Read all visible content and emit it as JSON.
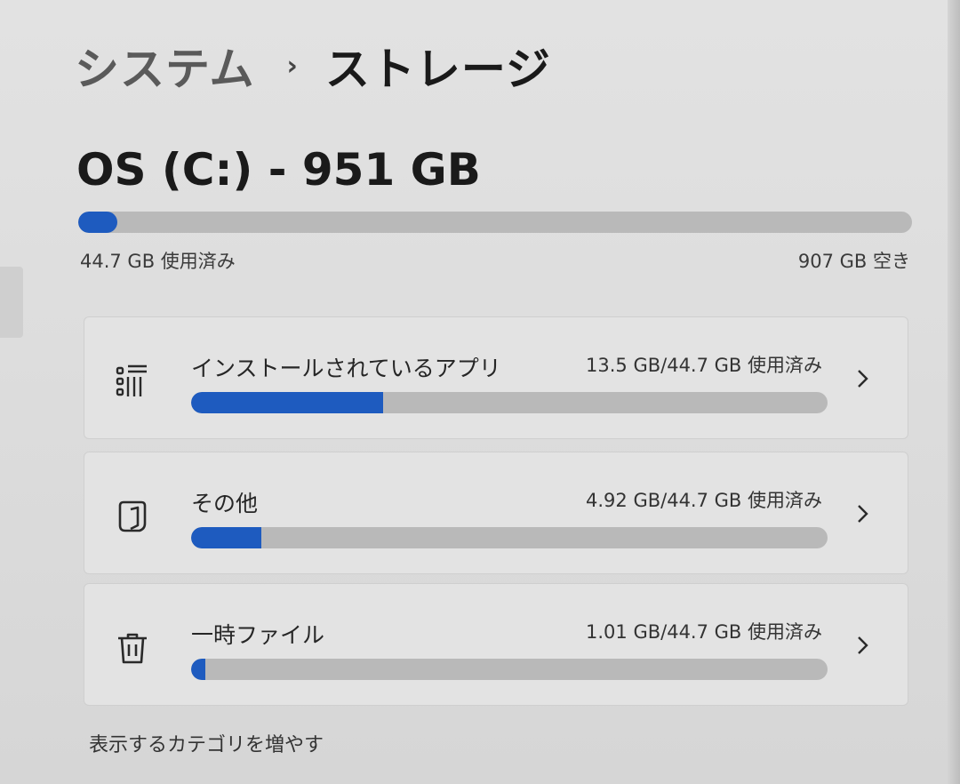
{
  "breadcrumb": {
    "parent": "システム",
    "separator": "›",
    "current": "ストレージ"
  },
  "drive": {
    "title": "OS (C:) - 951 GB",
    "used_label": "44.7 GB 使用済み",
    "free_label": "907 GB 空き",
    "used_fraction": 0.047
  },
  "categories": [
    {
      "name": "インストールされているアプリ",
      "usage": "13.5 GB/44.7 GB 使用済み",
      "fraction": 0.302,
      "icon": "apps-list-icon"
    },
    {
      "name": "その他",
      "usage": "4.92 GB/44.7 GB 使用済み",
      "fraction": 0.11,
      "icon": "other-documents-icon"
    },
    {
      "name": "一時ファイル",
      "usage": "1.01 GB/44.7 GB 使用済み",
      "fraction": 0.023,
      "icon": "trash-icon"
    }
  ],
  "more_link": "表示するカテゴリを増やす",
  "colors": {
    "accent": "#1e5bbf",
    "track": "#b9b9b9",
    "background": "#dddddd",
    "card": "#e3e3e3"
  }
}
